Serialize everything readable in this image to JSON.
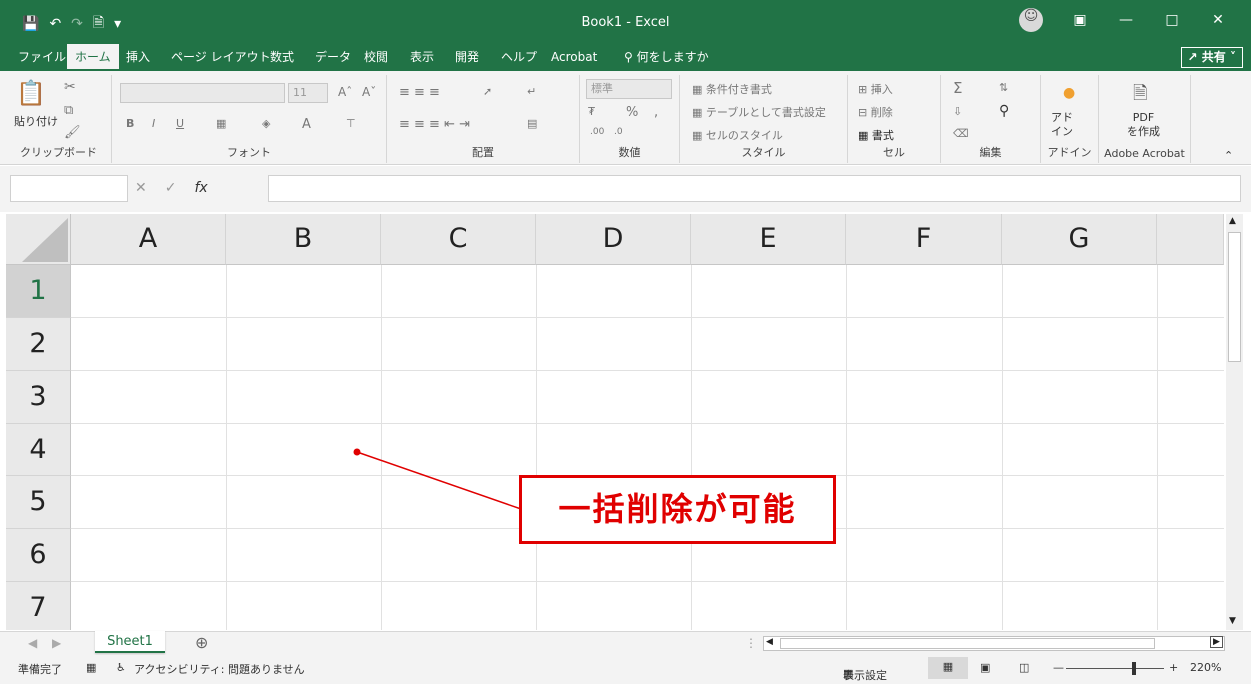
{
  "titlebar": {
    "title": "Book1  -  Excel",
    "qat": [
      "save-icon",
      "undo-icon",
      "redo-icon",
      "print-preview-icon",
      "customize-icon"
    ]
  },
  "menu": {
    "tabs": [
      "ファイル",
      "ホーム",
      "挿入",
      "ページ レイアウト",
      "数式",
      "データ",
      "校閲",
      "表示",
      "開発",
      "ヘルプ",
      "Acrobat"
    ],
    "active": "ホーム",
    "tell_me": "何をしますか",
    "share": "共有"
  },
  "ribbon": {
    "clipboard": {
      "paste": "貼り付け",
      "label": "クリップボード"
    },
    "font": {
      "size": "11",
      "label": "フォント"
    },
    "alignment": {
      "label": "配置"
    },
    "number": {
      "format": "標準",
      "label": "数値"
    },
    "styles": {
      "conditional": "条件付き書式",
      "table": "テーブルとして書式設定",
      "cell": "セルのスタイル",
      "label": "スタイル"
    },
    "cells": {
      "insert": "挿入",
      "delete": "削除",
      "format": "書式",
      "label": "セル"
    },
    "editing": {
      "label": "編集"
    },
    "addins": {
      "button": "アド\nイン",
      "label": "アドイン"
    },
    "acrobat": {
      "button": "PDF\nを作成",
      "label": "Adobe Acrobat"
    }
  },
  "formula_bar": {
    "name_box": "",
    "formula": ""
  },
  "grid": {
    "columns": [
      "A",
      "B",
      "C",
      "D",
      "E",
      "F",
      "G"
    ],
    "rows": [
      "1",
      "2",
      "3",
      "4",
      "5",
      "6",
      "7"
    ],
    "selected_row": "1"
  },
  "sheets": {
    "tabs": [
      "Sheet1"
    ]
  },
  "status": {
    "ready": "準備完了",
    "accessibility": "アクセシビリティ: 問題ありません",
    "display_settings": "表示設定",
    "zoom": "220%"
  },
  "annotation": {
    "text": "一括削除が可能",
    "color": "#e00000"
  },
  "colors": {
    "accent": "#217346"
  }
}
